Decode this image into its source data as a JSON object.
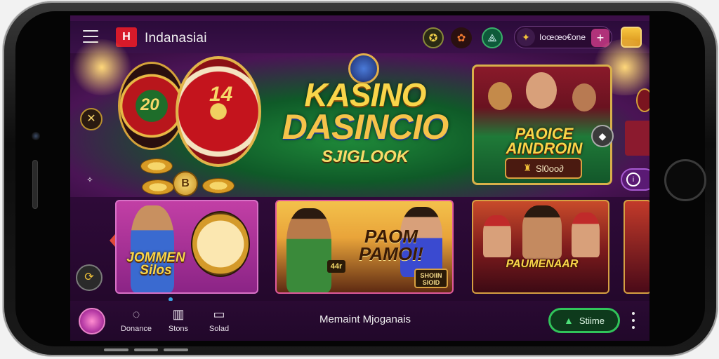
{
  "app": {
    "brand": "Indanasiai",
    "logo_text": "H"
  },
  "topbar": {
    "menu_icon": "hamburger-icon",
    "icons": [
      "gear-badge-icon",
      "bag-icon",
      "triangle-logo-icon"
    ],
    "wallet_text": "Ioœœo€one",
    "wallet_plus": "+",
    "avatar_icon": "gift-avatar-icon"
  },
  "hero": {
    "title_line1": "KASINO",
    "title_line2": "DASINCIO",
    "title_line3": "SJIGLOOK",
    "wheel1_number": "20",
    "wheel2_number": "14",
    "coin_letter": "B",
    "featured": {
      "title": "PAOICE AINDROIN",
      "button_label": "Sl0oo∂",
      "button_icon": "trophy-icon"
    }
  },
  "games": [
    {
      "title": "JOMMEN Silos"
    },
    {
      "title": "PAOM PAMOI!",
      "sign": "44r",
      "plate": "SHOIIN SIOID"
    },
    {
      "title": "PAUMENAAR"
    },
    {
      "title": ""
    }
  ],
  "bottomnav": {
    "items": [
      {
        "label": "Donance",
        "icon": "refresh-icon"
      },
      {
        "label": "Stons",
        "icon": "book-icon"
      },
      {
        "label": "Solad",
        "icon": "wallet-card-icon"
      }
    ],
    "status_text": "Memaint Mjoganais",
    "cta_label": "Stiime",
    "cta_icon": "triangle-icon"
  },
  "colors": {
    "accent_purple": "#3b0f48",
    "gold": "#f8d54a",
    "cta_green": "#31c45a"
  }
}
